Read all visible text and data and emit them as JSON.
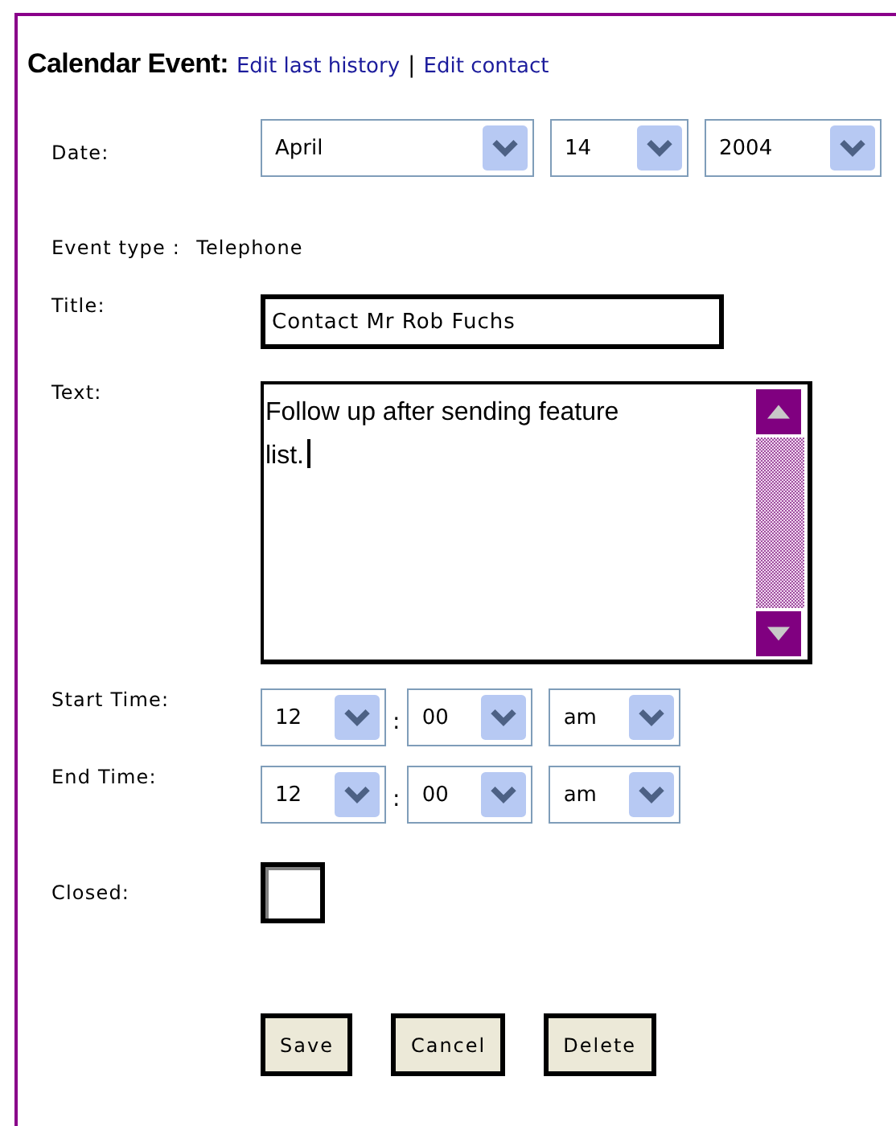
{
  "heading": {
    "title": "Calendar Event:",
    "links": [
      "Edit last history",
      "Edit contact"
    ],
    "separator": "|"
  },
  "date": {
    "label": "Date:",
    "selects": [
      "April",
      "14",
      "2004"
    ]
  },
  "event_type": {
    "label": "Event type :",
    "value": "Telephone"
  },
  "title_field": {
    "label": "Title:",
    "value": "Contact Mr Rob Fuchs"
  },
  "text_field": {
    "label": "Text:",
    "value": "Follow up after sending feature list."
  },
  "start_time": {
    "label": "Start Time:",
    "hour": "12",
    "separator": ":",
    "minute": "00",
    "period": "am"
  },
  "end_time": {
    "label": "End Time:",
    "hour": "12",
    "separator": ":",
    "minute": "00",
    "period": "am"
  },
  "closed": {
    "label": "Closed:",
    "checked": false
  },
  "buttons": [
    "Save",
    "Cancel",
    "Delete"
  ]
}
